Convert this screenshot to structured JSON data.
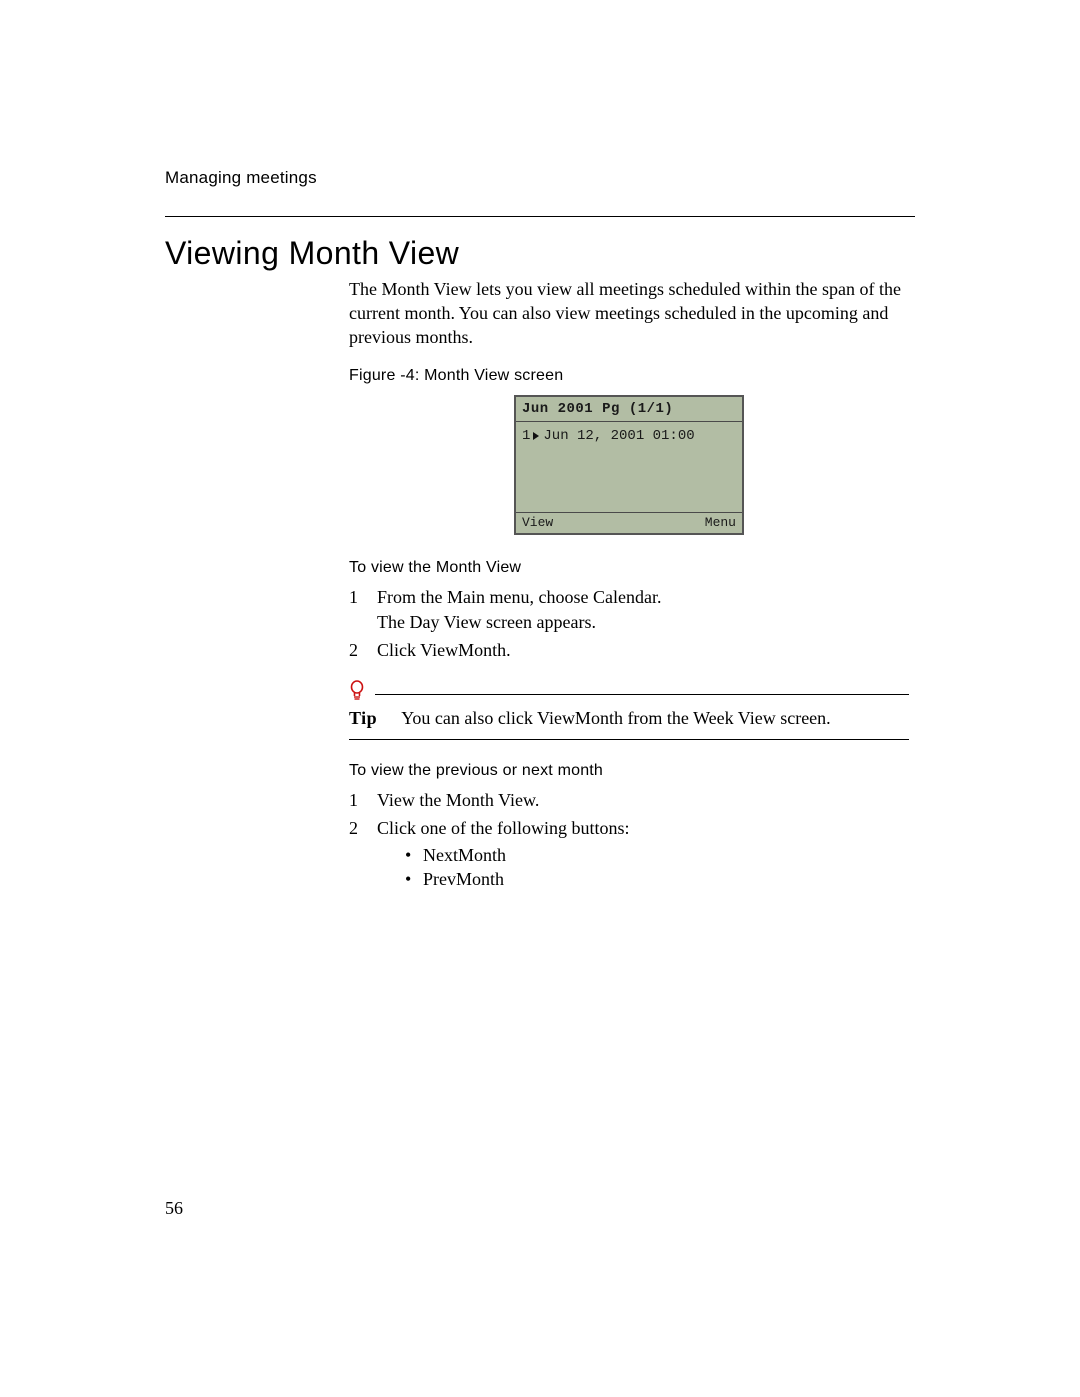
{
  "header": {
    "running_title": "Managing meetings"
  },
  "section": {
    "title": "Viewing Month View",
    "intro": "The Month View lets you view all meetings scheduled within the span of the current month. You can also view meetings scheduled in the upcoming and previous months."
  },
  "figure": {
    "caption": "Figure -4: Month View screen",
    "screen": {
      "title": "Jun 2001 Pg (1/1)",
      "items": [
        {
          "index": "1",
          "text": "Jun 12, 2001 01:00"
        }
      ],
      "soft_left": "View",
      "soft_right": "Menu"
    }
  },
  "procedures": [
    {
      "title": "To view the Month View",
      "steps": [
        {
          "num": "1",
          "text": "From the Main menu, choose Calendar.",
          "note": "The Day View screen appears."
        },
        {
          "num": "2",
          "text": "Click ViewMonth."
        }
      ]
    },
    {
      "title": "To view the previous or next month",
      "steps": [
        {
          "num": "1",
          "text": "View the Month View."
        },
        {
          "num": "2",
          "text": "Click one of the following buttons:",
          "bullets": [
            "NextMonth",
            "PrevMonth"
          ]
        }
      ]
    }
  ],
  "tip": {
    "label": "Tip",
    "text": "You can also click ViewMonth from the Week View screen."
  },
  "page_number": "56"
}
